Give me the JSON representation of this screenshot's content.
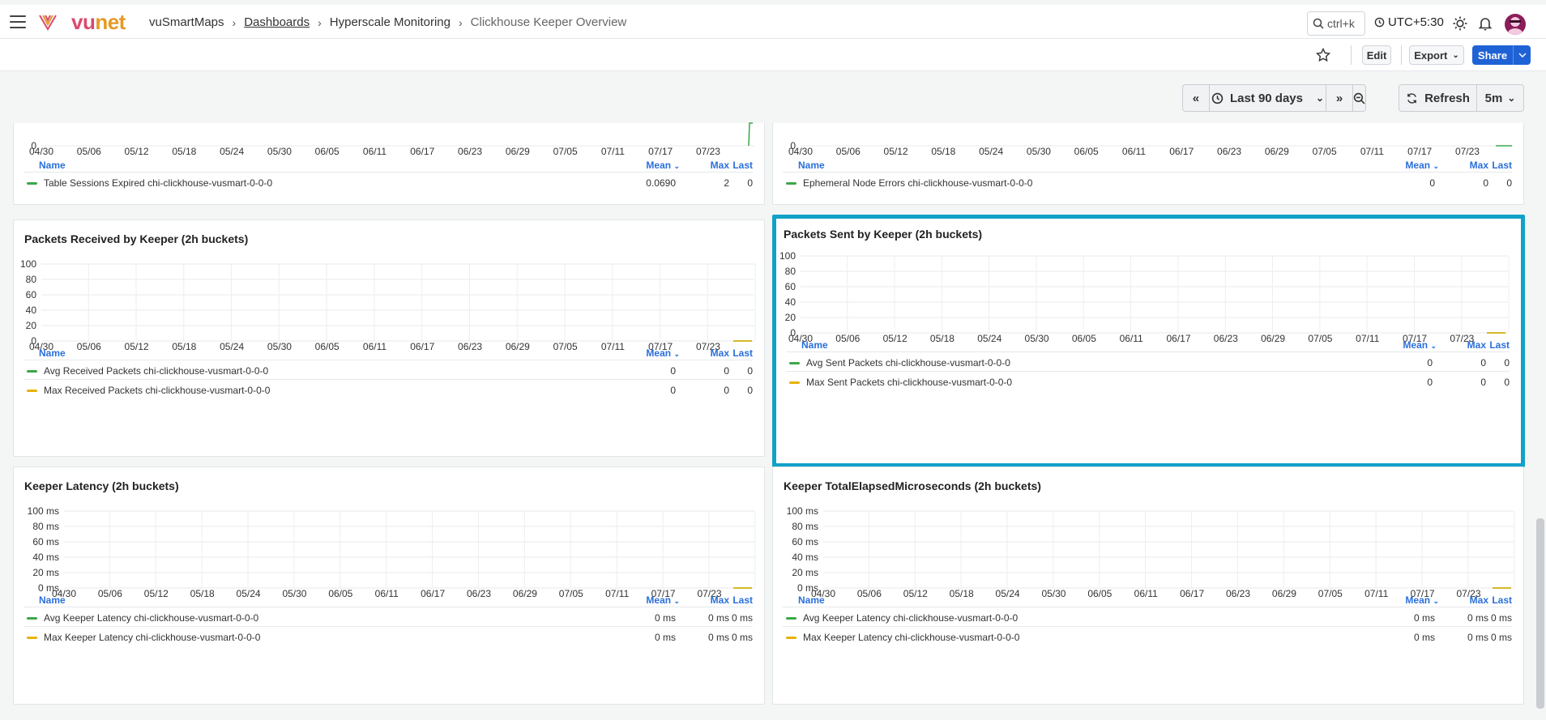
{
  "app": {
    "brand": "vunet",
    "brand_colors": [
      "#d94a6e",
      "#e59a25"
    ]
  },
  "breadcrumb": [
    "vuSmartMaps",
    "Dashboards",
    "Hyperscale Monitoring",
    "Clickhouse Keeper Overview"
  ],
  "header": {
    "search_label": "ctrl+k",
    "timezone": "UTC+5:30"
  },
  "toolbar": {
    "edit": "Edit",
    "export": "Export",
    "share": "Share"
  },
  "time": {
    "range": "Last 90 days",
    "refresh": "Refresh",
    "interval": "5m"
  },
  "legend_cols": {
    "name": "Name",
    "mean": "Mean",
    "max": "Max",
    "last": "Last"
  },
  "x_dates": [
    "04/30",
    "05/06",
    "05/12",
    "05/18",
    "05/24",
    "05/30",
    "06/05",
    "06/11",
    "06/17",
    "06/23",
    "06/29",
    "07/05",
    "07/11",
    "07/17",
    "07/23"
  ],
  "colors": {
    "green": "#3aa849",
    "yellow": "#e8b100",
    "highlight": "#12a1c8",
    "accent": "#2a6fdb"
  },
  "panels": [
    {
      "id": "p-sessions",
      "title": "",
      "yticks": [
        "0"
      ],
      "rows": [
        {
          "color": "green",
          "name": "Table Sessions Expired chi-clickhouse-vusmart-0-0-0",
          "mean": "0.0690",
          "max": "2",
          "last": "0"
        }
      ]
    },
    {
      "id": "p-ephemeral",
      "title": "",
      "yticks": [
        "0"
      ],
      "rows": [
        {
          "color": "green",
          "name": "Ephemeral Node Errors chi-clickhouse-vusmart-0-0-0",
          "mean": "0",
          "max": "0",
          "last": "0"
        }
      ]
    },
    {
      "id": "p-recv",
      "title": "Packets Received by Keeper (2h buckets)",
      "yticks": [
        "100",
        "80",
        "60",
        "40",
        "20",
        "0"
      ],
      "rows": [
        {
          "color": "green",
          "name": "Avg Received Packets chi-clickhouse-vusmart-0-0-0",
          "mean": "0",
          "max": "0",
          "last": "0"
        },
        {
          "color": "yellow",
          "name": "Max Received Packets chi-clickhouse-vusmart-0-0-0",
          "mean": "0",
          "max": "0",
          "last": "0"
        }
      ]
    },
    {
      "id": "p-sent",
      "title": "Packets Sent by Keeper (2h buckets)",
      "yticks": [
        "100",
        "80",
        "60",
        "40",
        "20",
        "0"
      ],
      "rows": [
        {
          "color": "green",
          "name": "Avg Sent Packets chi-clickhouse-vusmart-0-0-0",
          "mean": "0",
          "max": "0",
          "last": "0"
        },
        {
          "color": "yellow",
          "name": "Max Sent Packets chi-clickhouse-vusmart-0-0-0",
          "mean": "0",
          "max": "0",
          "last": "0"
        }
      ]
    },
    {
      "id": "p-latency",
      "title": "Keeper Latency (2h buckets)",
      "yticks": [
        "100 ms",
        "80 ms",
        "60 ms",
        "40 ms",
        "20 ms",
        "0 ms"
      ],
      "rows": [
        {
          "color": "green",
          "name": "Avg Keeper Latency chi-clickhouse-vusmart-0-0-0",
          "mean": "0 ms",
          "max": "0 ms",
          "last": "0 ms"
        },
        {
          "color": "yellow",
          "name": "Max Keeper Latency chi-clickhouse-vusmart-0-0-0",
          "mean": "0 ms",
          "max": "0 ms",
          "last": "0 ms"
        }
      ]
    },
    {
      "id": "p-elapsed",
      "title": "Keeper TotalElapsedMicroseconds (2h buckets)",
      "yticks": [
        "100 ms",
        "80 ms",
        "60 ms",
        "40 ms",
        "20 ms",
        "0 ms"
      ],
      "rows": [
        {
          "color": "green",
          "name": "Avg Keeper Latency chi-clickhouse-vusmart-0-0-0",
          "mean": "0 ms",
          "max": "0 ms",
          "last": "0 ms"
        },
        {
          "color": "yellow",
          "name": "Max Keeper Latency chi-clickhouse-vusmart-0-0-0",
          "mean": "0 ms",
          "max": "0 ms",
          "last": "0 ms"
        }
      ]
    }
  ],
  "chart_data": [
    {
      "type": "line",
      "title": "",
      "xlabel": "",
      "ylabel": "",
      "categories": [
        "04/30",
        "05/06",
        "05/12",
        "05/18",
        "05/24",
        "05/30",
        "06/05",
        "06/11",
        "06/17",
        "06/23",
        "06/29",
        "07/05",
        "07/11",
        "07/17",
        "07/23"
      ],
      "series": [
        {
          "name": "Table Sessions Expired chi-clickhouse-vusmart-0-0-0",
          "values": [
            0,
            0,
            0,
            0,
            0,
            0,
            0,
            0,
            0,
            0,
            0,
            0,
            0,
            0,
            2
          ]
        }
      ]
    },
    {
      "type": "line",
      "title": "",
      "xlabel": "",
      "ylabel": "",
      "categories": [
        "04/30",
        "05/06",
        "05/12",
        "05/18",
        "05/24",
        "05/30",
        "06/05",
        "06/11",
        "06/17",
        "06/23",
        "06/29",
        "07/05",
        "07/11",
        "07/17",
        "07/23"
      ],
      "series": [
        {
          "name": "Ephemeral Node Errors chi-clickhouse-vusmart-0-0-0",
          "values": [
            0,
            0,
            0,
            0,
            0,
            0,
            0,
            0,
            0,
            0,
            0,
            0,
            0,
            0,
            0
          ]
        }
      ]
    },
    {
      "type": "line",
      "title": "Packets Received by Keeper (2h buckets)",
      "ylim": [
        0,
        100
      ],
      "categories": [
        "04/30",
        "05/06",
        "05/12",
        "05/18",
        "05/24",
        "05/30",
        "06/05",
        "06/11",
        "06/17",
        "06/23",
        "06/29",
        "07/05",
        "07/11",
        "07/17",
        "07/23"
      ],
      "series": [
        {
          "name": "Avg Received Packets chi-clickhouse-vusmart-0-0-0",
          "values": [
            0
          ]
        },
        {
          "name": "Max Received Packets chi-clickhouse-vusmart-0-0-0",
          "values": [
            0
          ]
        }
      ]
    },
    {
      "type": "line",
      "title": "Packets Sent by Keeper (2h buckets)",
      "ylim": [
        0,
        100
      ],
      "categories": [
        "04/30",
        "05/06",
        "05/12",
        "05/18",
        "05/24",
        "05/30",
        "06/05",
        "06/11",
        "06/17",
        "06/23",
        "06/29",
        "07/05",
        "07/11",
        "07/17",
        "07/23"
      ],
      "series": [
        {
          "name": "Avg Sent Packets chi-clickhouse-vusmart-0-0-0",
          "values": [
            0
          ]
        },
        {
          "name": "Max Sent Packets chi-clickhouse-vusmart-0-0-0",
          "values": [
            0
          ]
        }
      ]
    },
    {
      "type": "line",
      "title": "Keeper Latency (2h buckets)",
      "ylim": [
        0,
        100
      ],
      "categories": [
        "04/30",
        "05/06",
        "05/12",
        "05/18",
        "05/24",
        "05/30",
        "06/05",
        "06/11",
        "06/17",
        "06/23",
        "06/29",
        "07/05",
        "07/11",
        "07/17",
        "07/23"
      ],
      "series": [
        {
          "name": "Avg Keeper Latency chi-clickhouse-vusmart-0-0-0",
          "values": [
            0
          ]
        },
        {
          "name": "Max Keeper Latency chi-clickhouse-vusmart-0-0-0",
          "values": [
            0
          ]
        }
      ]
    },
    {
      "type": "line",
      "title": "Keeper TotalElapsedMicroseconds (2h buckets)",
      "ylim": [
        0,
        100
      ],
      "categories": [
        "04/30",
        "05/06",
        "05/12",
        "05/18",
        "05/24",
        "05/30",
        "06/05",
        "06/11",
        "06/17",
        "06/23",
        "06/29",
        "07/05",
        "07/11",
        "07/17",
        "07/23"
      ],
      "series": [
        {
          "name": "Avg Keeper Latency chi-clickhouse-vusmart-0-0-0",
          "values": [
            0
          ]
        },
        {
          "name": "Max Keeper Latency chi-clickhouse-vusmart-0-0-0",
          "values": [
            0
          ]
        }
      ]
    }
  ]
}
